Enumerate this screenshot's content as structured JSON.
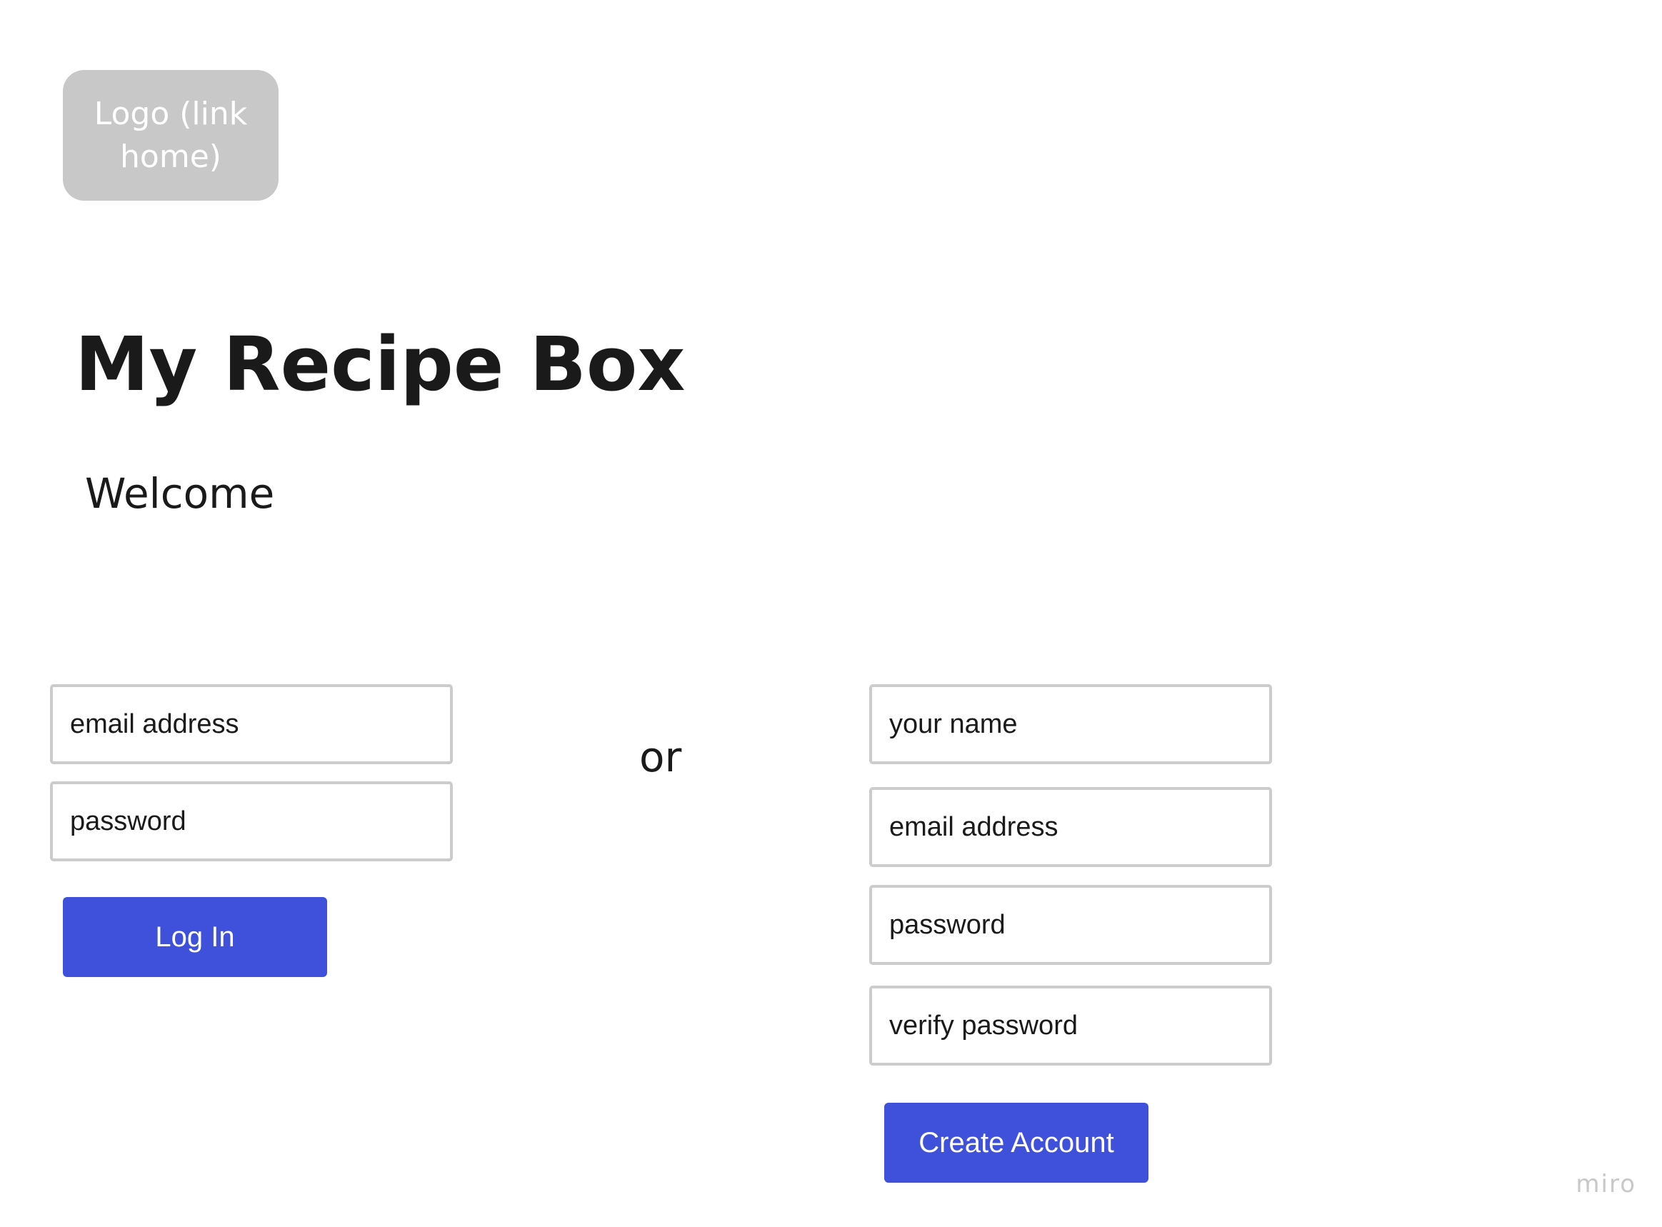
{
  "header": {
    "logo_label": "Logo (link home)"
  },
  "main": {
    "title": "My Recipe Box",
    "welcome": "Welcome",
    "separator": "or"
  },
  "login_form": {
    "email_placeholder": "email address",
    "password_placeholder": "password",
    "submit_label": "Log In"
  },
  "signup_form": {
    "name_placeholder": "your name",
    "email_placeholder": "email address",
    "password_placeholder": "password",
    "verify_password_placeholder": "verify password",
    "submit_label": "Create Account"
  },
  "footer": {
    "watermark": "miro"
  },
  "colors": {
    "primary_button": "#3f51da",
    "logo_background": "#c8c8c8",
    "field_border": "#cccccc"
  }
}
